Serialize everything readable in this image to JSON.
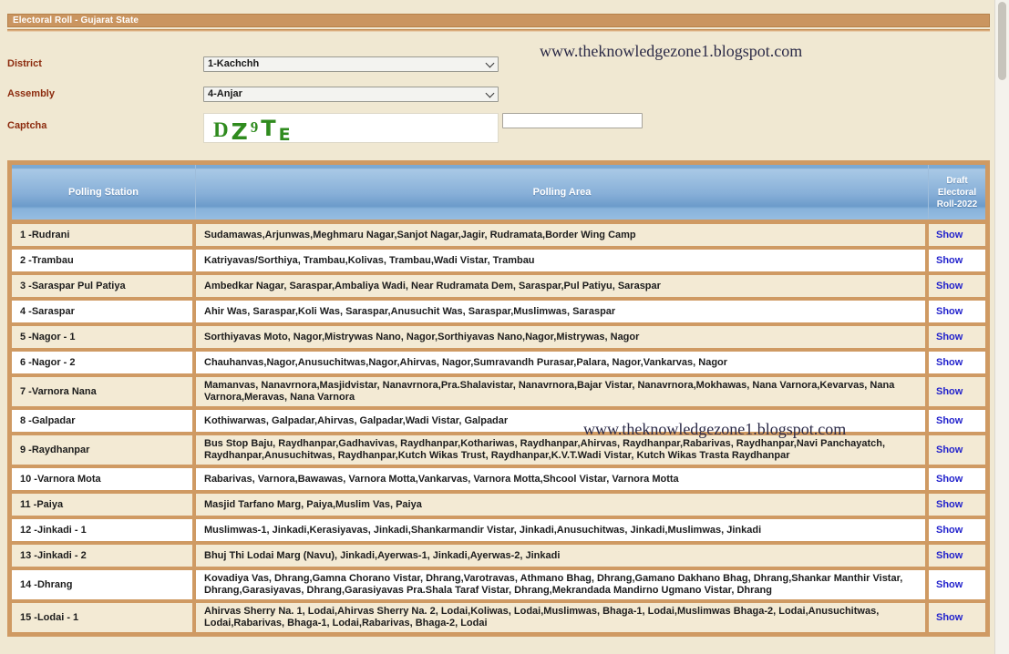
{
  "window": {
    "title": "Electoral Roll - Gujarat State"
  },
  "watermark": {
    "text": "www.theknowledgezone1.blogspot.com"
  },
  "form": {
    "district": {
      "label": "District",
      "value": "1-Kachchh"
    },
    "assembly": {
      "label": "Assembly",
      "value": "4-Anjar"
    },
    "captcha": {
      "label": "Captcha",
      "image_text": "DZ9TE",
      "chars": [
        "D",
        "Z",
        "9",
        "T",
        "E"
      ],
      "input_value": "",
      "input_placeholder": ""
    }
  },
  "colors": {
    "titlebar": "#ca9560",
    "page_background": "#f0e8d2",
    "table_border": "#cf9a63",
    "header_blue": "#88b0d8",
    "label_text": "#8c2b0e",
    "link_blue": "#2222cc",
    "captcha_green": "#2f8b1e"
  },
  "table": {
    "headers": {
      "polling_station": "Polling Station",
      "polling_area": "Polling Area",
      "draft_roll": "Draft Electoral Roll-2022"
    },
    "action_label": "Show",
    "rows": [
      {
        "station": "1 -Rudrani",
        "area": "Sudamawas,Arjunwas,Meghmaru Nagar,Sanjot Nagar,Jagir, Rudramata,Border Wing Camp",
        "action": "Show"
      },
      {
        "station": "2 -Trambau",
        "area": "Katriyavas/Sorthiya, Trambau,Kolivas, Trambau,Wadi Vistar, Trambau",
        "action": "Show"
      },
      {
        "station": "3 -Saraspar Pul Patiya",
        "area": "Ambedkar Nagar, Saraspar,Ambaliya Wadi, Near Rudramata Dem, Saraspar,Pul Patiyu, Saraspar",
        "action": "Show"
      },
      {
        "station": "4 -Saraspar",
        "area": "Ahir Was, Saraspar,Koli Was, Saraspar,Anusuchit Was, Saraspar,Muslimwas, Saraspar",
        "action": "Show"
      },
      {
        "station": "5 -Nagor - 1",
        "area": "Sorthiyavas Moto, Nagor,Mistrywas Nano, Nagor,Sorthiyavas Nano,Nagor,Mistrywas, Nagor",
        "action": "Show"
      },
      {
        "station": "6 -Nagor - 2",
        "area": "Chauhanvas,Nagor,Anusuchitwas,Nagor,Ahirvas, Nagor,Sumravandh Purasar,Palara, Nagor,Vankarvas, Nagor",
        "action": "Show"
      },
      {
        "station": "7 -Varnora Nana",
        "area": "Mamanvas, Nanavrnora,Masjidvistar, Nanavrnora,Pra.Shalavistar, Nanavrnora,Bajar Vistar, Nanavrnora,Mokhawas, Nana Varnora,Kevarvas, Nana Varnora,Meravas, Nana Varnora",
        "action": "Show"
      },
      {
        "station": "8 -Galpadar",
        "area": "Kothiwarwas, Galpadar,Ahirvas, Galpadar,Wadi Vistar, Galpadar",
        "action": "Show"
      },
      {
        "station": "9 -Raydhanpar",
        "area": "Bus Stop Baju, Raydhanpar,Gadhavivas, Raydhanpar,Kothariwas, Raydhanpar,Ahirvas, Raydhanpar,Rabarivas, Raydhanpar,Navi Panchayatch, Raydhanpar,Anusuchitwas, Raydhanpar,Kutch Wikas Trust, Raydhanpar,K.V.T.Wadi Vistar, Kutch Wikas Trasta Raydhanpar",
        "action": "Show"
      },
      {
        "station": "10 -Varnora Mota",
        "area": "Rabarivas, Varnora,Bawawas, Varnora Motta,Vankarvas, Varnora Motta,Shcool Vistar, Varnora Motta",
        "action": "Show"
      },
      {
        "station": "11 -Paiya",
        "area": "Masjid Tarfano Marg, Paiya,Muslim Vas, Paiya",
        "action": "Show"
      },
      {
        "station": "12 -Jinkadi - 1",
        "area": "Muslimwas-1, Jinkadi,Kerasiyavas, Jinkadi,Shankarmandir Vistar, Jinkadi,Anusuchitwas, Jinkadi,Muslimwas, Jinkadi",
        "action": "Show"
      },
      {
        "station": "13 -Jinkadi - 2",
        "area": "Bhuj Thi Lodai Marg (Navu), Jinkadi,Ayerwas-1, Jinkadi,Ayerwas-2, Jinkadi",
        "action": "Show"
      },
      {
        "station": "14 -Dhrang",
        "area": "Kovadiya Vas, Dhrang,Gamna Chorano Vistar, Dhrang,Varotravas, Athmano Bhag, Dhrang,Gamano Dakhano Bhag, Dhrang,Shankar Manthir Vistar, Dhrang,Garasiyavas, Dhrang,Garasiyavas Pra.Shala Taraf Vistar, Dhrang,Mekrandada Mandirno Ugmano Vistar, Dhrang",
        "action": "Show"
      },
      {
        "station": "15 -Lodai - 1",
        "area": "Ahirvas Sherry Na. 1, Lodai,Ahirvas Sherry Na. 2, Lodai,Koliwas, Lodai,Muslimwas, Bhaga-1, Lodai,Muslimwas Bhaga-2, Lodai,Anusuchitwas, Lodai,Rabarivas, Bhaga-1, Lodai,Rabarivas, Bhaga-2, Lodai",
        "action": "Show"
      }
    ]
  }
}
